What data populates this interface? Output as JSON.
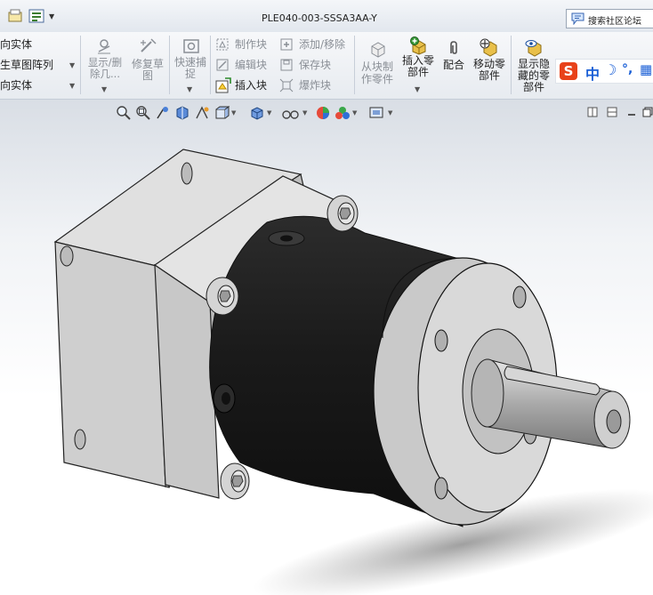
{
  "window": {
    "title": "PLE040-003-SSSA3AA-Y",
    "search_placeholder": "搜索社区论坛"
  },
  "ribbon": {
    "left_items": [
      "向实体",
      "生草图阵列",
      "向实体"
    ],
    "display_delete": "显示/删除几...",
    "repair_sketch": "修复草图",
    "quick_snap": "快速捕捉",
    "block_tools": {
      "make_block": "制作块",
      "edit_block": "编辑块",
      "insert_block": "插入块",
      "add_remove": "添加/移除",
      "save_block": "保存块",
      "explode_block": "爆炸块"
    },
    "make_part_from_block": "从块制作零件",
    "insert_component": "插入零部件",
    "mate": "配合",
    "move_component": "移动零部件",
    "show_hidden": "显示隐藏的零部件"
  },
  "ime_bar": {
    "logo": "S",
    "mode": "中",
    "moon": "☽",
    "punct": "°,",
    "grid": "▦"
  },
  "colors": {
    "motor_body": "#c9c9c9",
    "gear_barrel": "#1f1f1f",
    "flange": "#d3d3d3",
    "shaft": "#b8b8b8",
    "viewport_top": "#d9dee5",
    "ime_accent": "#e8421a",
    "ime_blue": "#1a5fd6"
  },
  "icons": {
    "view_toolbar": [
      "zoom-to-fit-icon",
      "zoom-area-icon",
      "previous-view-icon",
      "section-view-icon",
      "dynamic-annotation-icon",
      "view-orientation-icon",
      "display-style-icon",
      "hide-show-items-icon",
      "edit-appearance-icon",
      "apply-scene-icon",
      "view-setting-icon"
    ]
  }
}
